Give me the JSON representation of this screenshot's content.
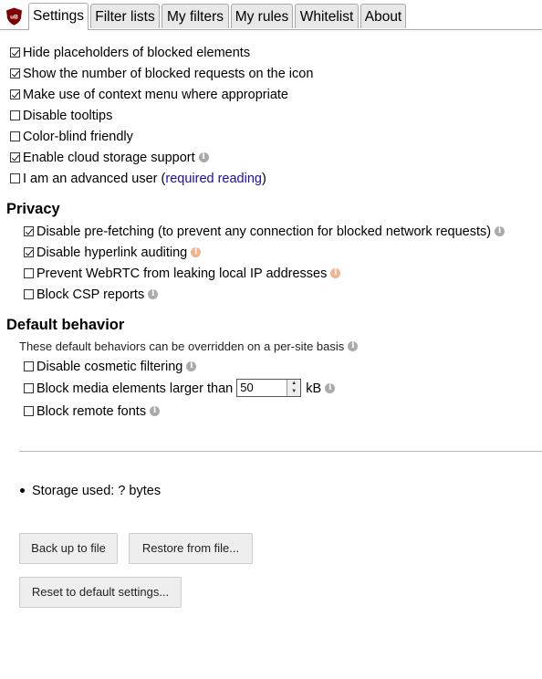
{
  "tabs": [
    "Settings",
    "Filter lists",
    "My filters",
    "My rules",
    "Whitelist",
    "About"
  ],
  "logo_text": "uB",
  "general": [
    {
      "label": "Hide placeholders of blocked elements",
      "checked": true
    },
    {
      "label": "Show the number of blocked requests on the icon",
      "checked": true
    },
    {
      "label": "Make use of context menu where appropriate",
      "checked": true
    },
    {
      "label": "Disable tooltips",
      "checked": false
    },
    {
      "label": "Color-blind friendly",
      "checked": false
    },
    {
      "label": "Enable cloud storage support",
      "checked": true,
      "info": true
    },
    {
      "label": "I am an advanced user (",
      "link": "required reading",
      "suffix": ")",
      "checked": false
    }
  ],
  "privacy": {
    "title": "Privacy",
    "items": [
      {
        "label": "Disable pre-fetching (to prevent any connection for blocked network requests)",
        "checked": true,
        "info": "grey"
      },
      {
        "label": "Disable hyperlink auditing",
        "checked": true,
        "info": "warn"
      },
      {
        "label": "Prevent WebRTC from leaking local IP addresses",
        "checked": false,
        "info": "warn"
      },
      {
        "label": "Block CSP reports",
        "checked": false,
        "info": "grey"
      }
    ]
  },
  "default_behavior": {
    "title": "Default behavior",
    "note": "These default behaviors can be overridden on a per-site basis",
    "items": [
      {
        "label": "Disable cosmetic filtering",
        "checked": false
      },
      {
        "label": "Block media elements larger than",
        "checked": false,
        "value": "50",
        "unit": "kB"
      },
      {
        "label": "Block remote fonts",
        "checked": false
      }
    ]
  },
  "storage": "Storage used: ? bytes",
  "buttons": {
    "backup": "Back up to file",
    "restore": "Restore from file...",
    "reset": "Reset to default settings..."
  },
  "info_glyph": "i",
  "spin_glyphs": {
    "up": "▲",
    "down": "▼"
  }
}
